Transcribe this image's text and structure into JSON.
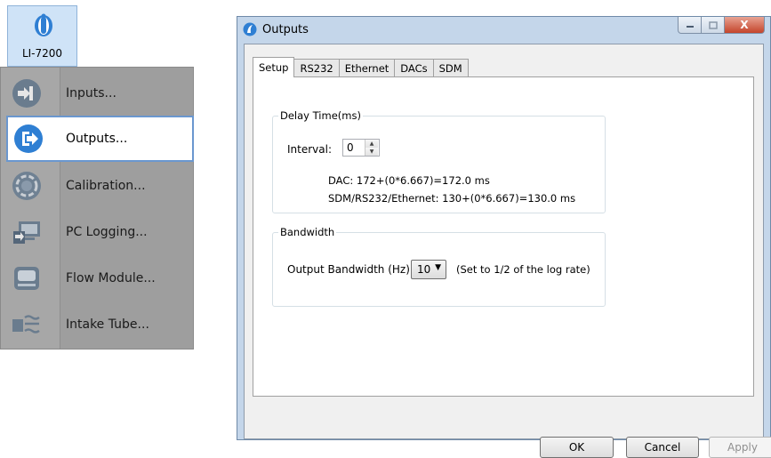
{
  "device": {
    "label": "LI-7200",
    "icon": "li-cor-logo-icon"
  },
  "menu": {
    "items": [
      {
        "label": "Inputs...",
        "icon": "inputs-icon",
        "selected": false
      },
      {
        "label": "Outputs...",
        "icon": "outputs-icon",
        "selected": true
      },
      {
        "label": "Calibration...",
        "icon": "calibration-icon",
        "selected": false
      },
      {
        "label": "PC Logging...",
        "icon": "pc-logging-icon",
        "selected": false
      },
      {
        "label": "Flow Module...",
        "icon": "flow-module-icon",
        "selected": false
      },
      {
        "label": "Intake Tube...",
        "icon": "intake-tube-icon",
        "selected": false
      }
    ]
  },
  "dialog": {
    "title": "Outputs",
    "tabs": [
      "Setup",
      "RS232",
      "Ethernet",
      "DACs",
      "SDM"
    ],
    "active_tab": "Setup",
    "delay": {
      "group_title": "Delay Time(ms)",
      "interval_label": "Interval:",
      "interval_value": "0",
      "dac_line": "DAC: 172+(0*6.667)=172.0 ms",
      "sdm_line": "SDM/RS232/Ethernet: 130+(0*6.667)=130.0 ms"
    },
    "bandwidth": {
      "group_title": "Bandwidth",
      "label": "Output Bandwidth (Hz):",
      "value": "10",
      "note": "(Set to 1/2 of the log rate)"
    },
    "buttons": {
      "ok": "OK",
      "cancel": "Cancel",
      "apply": "Apply"
    },
    "window_buttons": {
      "close": "X"
    }
  },
  "colors": {
    "menu_bg": "#9e9e9e",
    "selected_border": "#6a97cf",
    "icon_blue": "#2f7fd3",
    "dialog_frame": "#c4d6ea"
  }
}
